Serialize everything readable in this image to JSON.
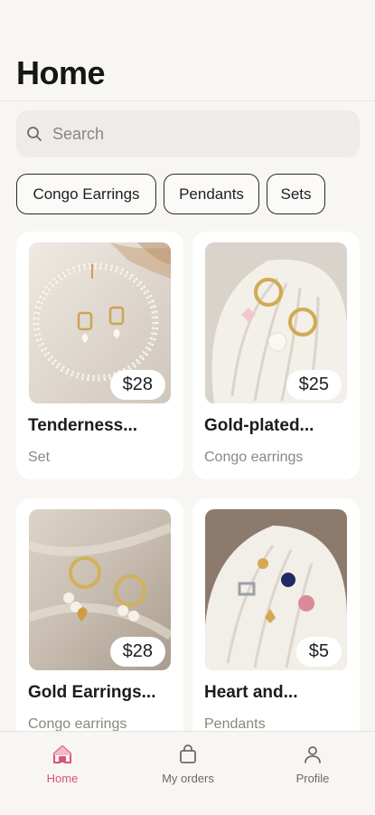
{
  "header": {
    "title": "Home"
  },
  "search": {
    "placeholder": "Search",
    "icon": "search-icon"
  },
  "categories": [
    {
      "label": "Congo Earrings"
    },
    {
      "label": "Pendants"
    },
    {
      "label": "Sets"
    }
  ],
  "products": [
    {
      "name": "Tenderness...",
      "category": "Set",
      "price": "$28"
    },
    {
      "name": "Gold-plated...",
      "category": "Congo earrings",
      "price": "$25"
    },
    {
      "name": "Gold Earrings...",
      "category": "Congo earrings",
      "price": "$28"
    },
    {
      "name": "Heart and...",
      "category": "Pendants",
      "price": "$5"
    }
  ],
  "tabbar": {
    "active": "Home",
    "tabs": [
      {
        "label": "Home",
        "icon": "home-icon"
      },
      {
        "label": "My orders",
        "icon": "shopping-bag-icon"
      },
      {
        "label": "Profile",
        "icon": "user-icon"
      }
    ]
  },
  "colors": {
    "accent": "#d9537a",
    "background": "#f8f6f3",
    "card": "#ffffff"
  }
}
